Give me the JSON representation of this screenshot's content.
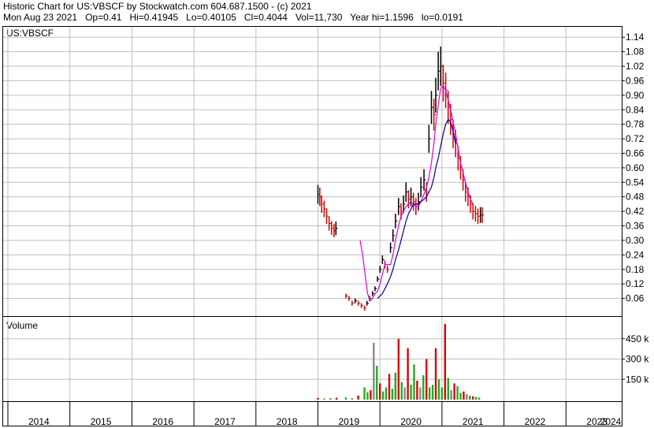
{
  "header": {
    "line1": "Historic Chart for US:VBSCF by Stockwatch.com 604.687.1500 - (c) 2021",
    "line2": "Mon Aug 23 2021   Op=0.41   Hi=0.41945   Lo=0.40105   Cl=0.4044   Vol=11,730   Year hi=1.1596   lo=0.0191"
  },
  "colors": {
    "background": "#ffffff",
    "grid": "#bfbfbf",
    "frame": "#000000",
    "price_bar": "#000000",
    "down_day": "#d40000",
    "volume_up": "#22aa22",
    "volume_down": "#dd0000",
    "volume_neutral": "#888888",
    "ma_short": "#e000e0",
    "ma_long": "#000099"
  },
  "chart_data": [
    {
      "type": "line",
      "title": "US:VBSCF",
      "y_axis_position": "right",
      "grid": true,
      "ylim": [
        0,
        1.17
      ],
      "xlim": [
        2014.0,
        2024.2
      ],
      "y_ticks": [
        "1.14",
        "1.08",
        "1.02",
        "0.96",
        "0.90",
        "0.84",
        "0.78",
        "0.72",
        "0.66",
        "0.60",
        "0.54",
        "0.48",
        "0.42",
        "0.36",
        "0.30",
        "0.24",
        "0.18",
        "0.12",
        "0.06"
      ],
      "x_ticks": [
        "2014",
        "2015",
        "2016",
        "2017",
        "2018",
        "2019",
        "2020",
        "2021",
        "2022",
        "2023",
        "2024"
      ],
      "series": [
        {
          "kind": "price",
          "x": [
            2019.0,
            2019.03,
            2019.06,
            2019.1,
            2019.14,
            2019.18,
            2019.22,
            2019.26,
            2019.29,
            2019.45,
            2019.5,
            2019.55,
            2019.6,
            2019.65,
            2019.7,
            2019.75,
            2019.79,
            2019.83,
            2019.88,
            2019.92,
            2019.96,
            2020.0,
            2020.04,
            2020.08,
            2020.12,
            2020.17,
            2020.21,
            2020.25,
            2020.3,
            2020.34,
            2020.38,
            2020.42,
            2020.46,
            2020.5,
            2020.54,
            2020.58,
            2020.62,
            2020.66,
            2020.71,
            2020.75,
            2020.79,
            2020.83,
            2020.87,
            2020.9,
            2020.94,
            2020.98,
            2021.02,
            2021.06,
            2021.1,
            2021.14,
            2021.18,
            2021.22,
            2021.26,
            2021.3,
            2021.34,
            2021.38,
            2021.42,
            2021.46,
            2021.5,
            2021.54,
            2021.58,
            2021.62,
            2021.65
          ],
          "values": [
            0.49,
            0.48,
            0.45,
            0.43,
            0.4,
            0.37,
            0.35,
            0.34,
            0.35,
            0.07,
            0.06,
            0.04,
            0.05,
            0.04,
            0.03,
            0.02,
            0.04,
            0.06,
            0.08,
            0.1,
            0.14,
            0.18,
            0.22,
            0.2,
            0.18,
            0.27,
            0.32,
            0.38,
            0.44,
            0.42,
            0.45,
            0.5,
            0.47,
            0.48,
            0.46,
            0.44,
            0.46,
            0.52,
            0.55,
            0.5,
            0.72,
            0.85,
            0.82,
            0.9,
            1.0,
            1.02,
            0.95,
            0.92,
            0.85,
            0.8,
            0.74,
            0.7,
            0.64,
            0.6,
            0.55,
            0.5,
            0.48,
            0.45,
            0.42,
            0.41,
            0.4,
            0.405,
            0.4044
          ]
        },
        {
          "kind": "moving_average_short",
          "x": [
            2019.68,
            2019.72,
            2019.76,
            2019.8,
            2019.84,
            2019.88,
            2019.92,
            2019.96,
            2020.0,
            2020.04,
            2020.08,
            2020.12,
            2020.17,
            2020.21,
            2020.25,
            2020.3,
            2020.34,
            2020.38,
            2020.42,
            2020.46,
            2020.5,
            2020.54,
            2020.58,
            2020.62,
            2020.66,
            2020.71,
            2020.75,
            2020.79,
            2020.83,
            2020.87,
            2020.9,
            2020.94,
            2020.98,
            2021.02,
            2021.06,
            2021.1,
            2021.14,
            2021.18,
            2021.22,
            2021.26,
            2021.3,
            2021.34,
            2021.38,
            2021.42,
            2021.46,
            2021.5
          ],
          "values": [
            0.3,
            0.24,
            0.16,
            0.08,
            0.05,
            0.06,
            0.08,
            0.09,
            0.12,
            0.16,
            0.2,
            0.2,
            0.2,
            0.24,
            0.3,
            0.36,
            0.4,
            0.42,
            0.44,
            0.45,
            0.46,
            0.45,
            0.44,
            0.44,
            0.46,
            0.49,
            0.52,
            0.56,
            0.62,
            0.7,
            0.78,
            0.86,
            0.93,
            0.94,
            0.92,
            0.88,
            0.84,
            0.79,
            0.74,
            0.68,
            0.62,
            0.58,
            0.54,
            0.5,
            0.47,
            0.45
          ]
        },
        {
          "kind": "moving_average_long",
          "x": [
            2019.96,
            2020.0,
            2020.04,
            2020.08,
            2020.12,
            2020.17,
            2020.21,
            2020.25,
            2020.3,
            2020.34,
            2020.38,
            2020.42,
            2020.46,
            2020.5,
            2020.54,
            2020.58,
            2020.62,
            2020.66,
            2020.71,
            2020.75,
            2020.79,
            2020.83,
            2020.87,
            2020.9,
            2020.94,
            2020.98,
            2021.02,
            2021.06,
            2021.1,
            2021.14,
            2021.18,
            2021.22
          ],
          "values": [
            0.06,
            0.07,
            0.08,
            0.1,
            0.12,
            0.15,
            0.18,
            0.22,
            0.26,
            0.3,
            0.34,
            0.38,
            0.41,
            0.43,
            0.45,
            0.45,
            0.45,
            0.46,
            0.47,
            0.48,
            0.5,
            0.52,
            0.56,
            0.6,
            0.64,
            0.69,
            0.74,
            0.78,
            0.8,
            0.79,
            0.75,
            0.7
          ]
        }
      ]
    },
    {
      "type": "bar",
      "title": "Volume",
      "y_axis_position": "right",
      "grid": true,
      "ylim": [
        0,
        600
      ],
      "y_ticks": [
        "450 k",
        "300 k",
        "150 k"
      ],
      "series": [
        {
          "name": "Volume",
          "x": [
            2019.0,
            2019.1,
            2019.2,
            2019.3,
            2019.45,
            2019.55,
            2019.65,
            2019.75,
            2019.8,
            2019.85,
            2019.9,
            2019.95,
            2020.0,
            2020.05,
            2020.1,
            2020.15,
            2020.2,
            2020.25,
            2020.3,
            2020.35,
            2020.4,
            2020.45,
            2020.5,
            2020.55,
            2020.6,
            2020.65,
            2020.7,
            2020.75,
            2020.8,
            2020.85,
            2020.9,
            2020.95,
            2021.0,
            2021.05,
            2021.1,
            2021.15,
            2021.2,
            2021.25,
            2021.3,
            2021.35,
            2021.4,
            2021.45,
            2021.5,
            2021.55,
            2021.6
          ],
          "values": [
            12,
            8,
            10,
            14,
            16,
            12,
            30,
            90,
            55,
            70,
            420,
            250,
            120,
            60,
            90,
            190,
            80,
            200,
            450,
            130,
            90,
            380,
            110,
            260,
            140,
            90,
            180,
            300,
            90,
            110,
            380,
            150,
            90,
            560,
            160,
            70,
            120,
            100,
            50,
            60,
            40,
            30,
            25,
            20,
            15
          ]
        }
      ]
    }
  ]
}
